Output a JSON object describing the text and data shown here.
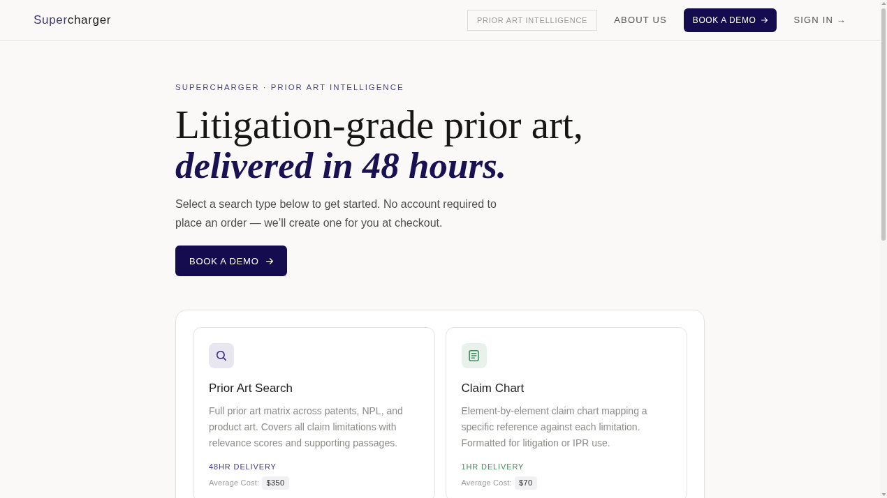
{
  "header": {
    "logo": {
      "accent": "Super",
      "rest": "charger"
    },
    "nav": [
      {
        "kind": "link",
        "label": "PRIOR ART INTELLIGENCE",
        "selected": true
      },
      {
        "kind": "link",
        "label": "ABOUT US",
        "selected": false
      },
      {
        "kind": "button",
        "label": "BOOK A DEMO",
        "selected": false
      },
      {
        "kind": "link",
        "label": "SIGN IN →",
        "selected": false
      }
    ]
  },
  "hero": {
    "eyebrow": "SUPERCHARGER · PRIOR ART INTELLIGENCE",
    "heading_line_1": "Litigation-grade prior art,",
    "heading_line_2": "delivered in 48 hours.",
    "subtitle": "Select a search type below to get started. No account required to place an order — we’ll create one for you at checkout.",
    "cta": {
      "label": "BOOK A DEMO"
    }
  },
  "services": [
    {
      "kind": "search",
      "color": "#3f3a85",
      "title": "Prior Art Search",
      "description": "Full prior art matrix across patents, NPL, and product art. Covers all claim limitations with relevance scores and supporting passages.",
      "delivery": "48HR DELIVERY",
      "cost_label": "Average Cost:",
      "price": "$350"
    },
    {
      "kind": "chart",
      "color": "#3d8c5c",
      "title": "Claim Chart",
      "description": "Element-by-element claim chart mapping a specific reference against each limitation. Formatted for litigation or IPR use.",
      "delivery": "1HR DELIVERY",
      "cost_label": "Average Cost:",
      "price": "$70"
    }
  ]
}
